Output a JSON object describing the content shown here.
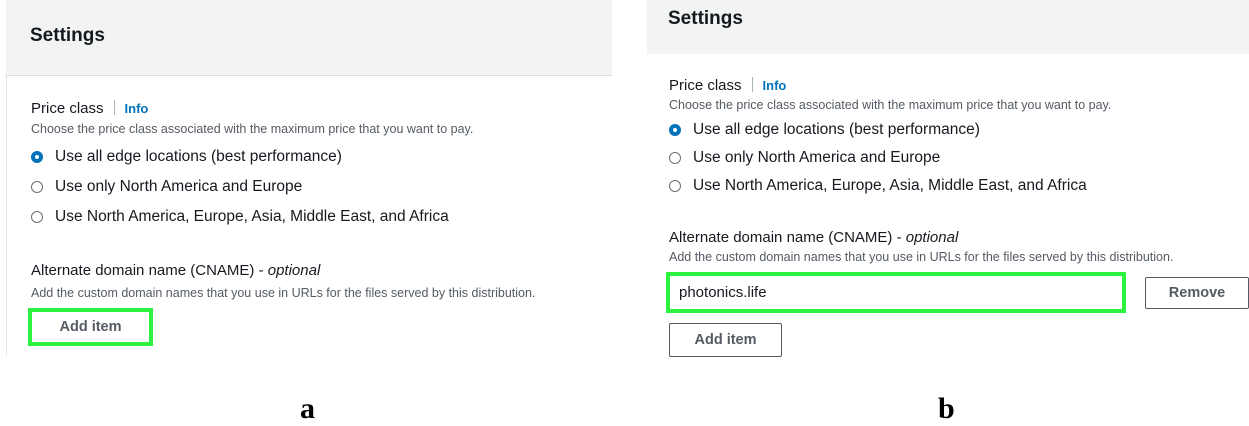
{
  "panel_a": {
    "header": {
      "title": "Settings"
    },
    "price_class": {
      "label": "Price class",
      "info_link": "Info",
      "description": "Choose the price class associated with the maximum price that you want to pay.",
      "options": [
        {
          "label": "Use all edge locations (best performance)",
          "selected": true
        },
        {
          "label": "Use only North America and Europe",
          "selected": false
        },
        {
          "label": "Use North America, Europe, Asia, Middle East, and Africa",
          "selected": false
        }
      ]
    },
    "cname": {
      "label": "Alternate domain name (CNAME) - ",
      "optional": "optional",
      "description": "Add the custom domain names that you use in URLs for the files served by this distribution.",
      "add_button": "Add item"
    },
    "caption": "a"
  },
  "panel_b": {
    "header": {
      "title": "Settings"
    },
    "price_class": {
      "label": "Price class",
      "info_link": "Info",
      "description": "Choose the price class associated with the maximum price that you want to pay.",
      "options": [
        {
          "label": "Use all edge locations (best performance)",
          "selected": true
        },
        {
          "label": "Use only North America and Europe",
          "selected": false
        },
        {
          "label": "Use North America, Europe, Asia, Middle East, and Africa",
          "selected": false
        }
      ]
    },
    "cname": {
      "label": "Alternate domain name (CNAME) - ",
      "optional": "optional",
      "description": "Add the custom domain names that you use in URLs for the files served by this distribution.",
      "input_value": "photonics.life",
      "remove_button": "Remove",
      "add_button": "Add item"
    },
    "caption": "b"
  },
  "colors": {
    "highlight": "#2bf33f",
    "link": "#0073bb",
    "header_bg": "#f2f3f3"
  }
}
